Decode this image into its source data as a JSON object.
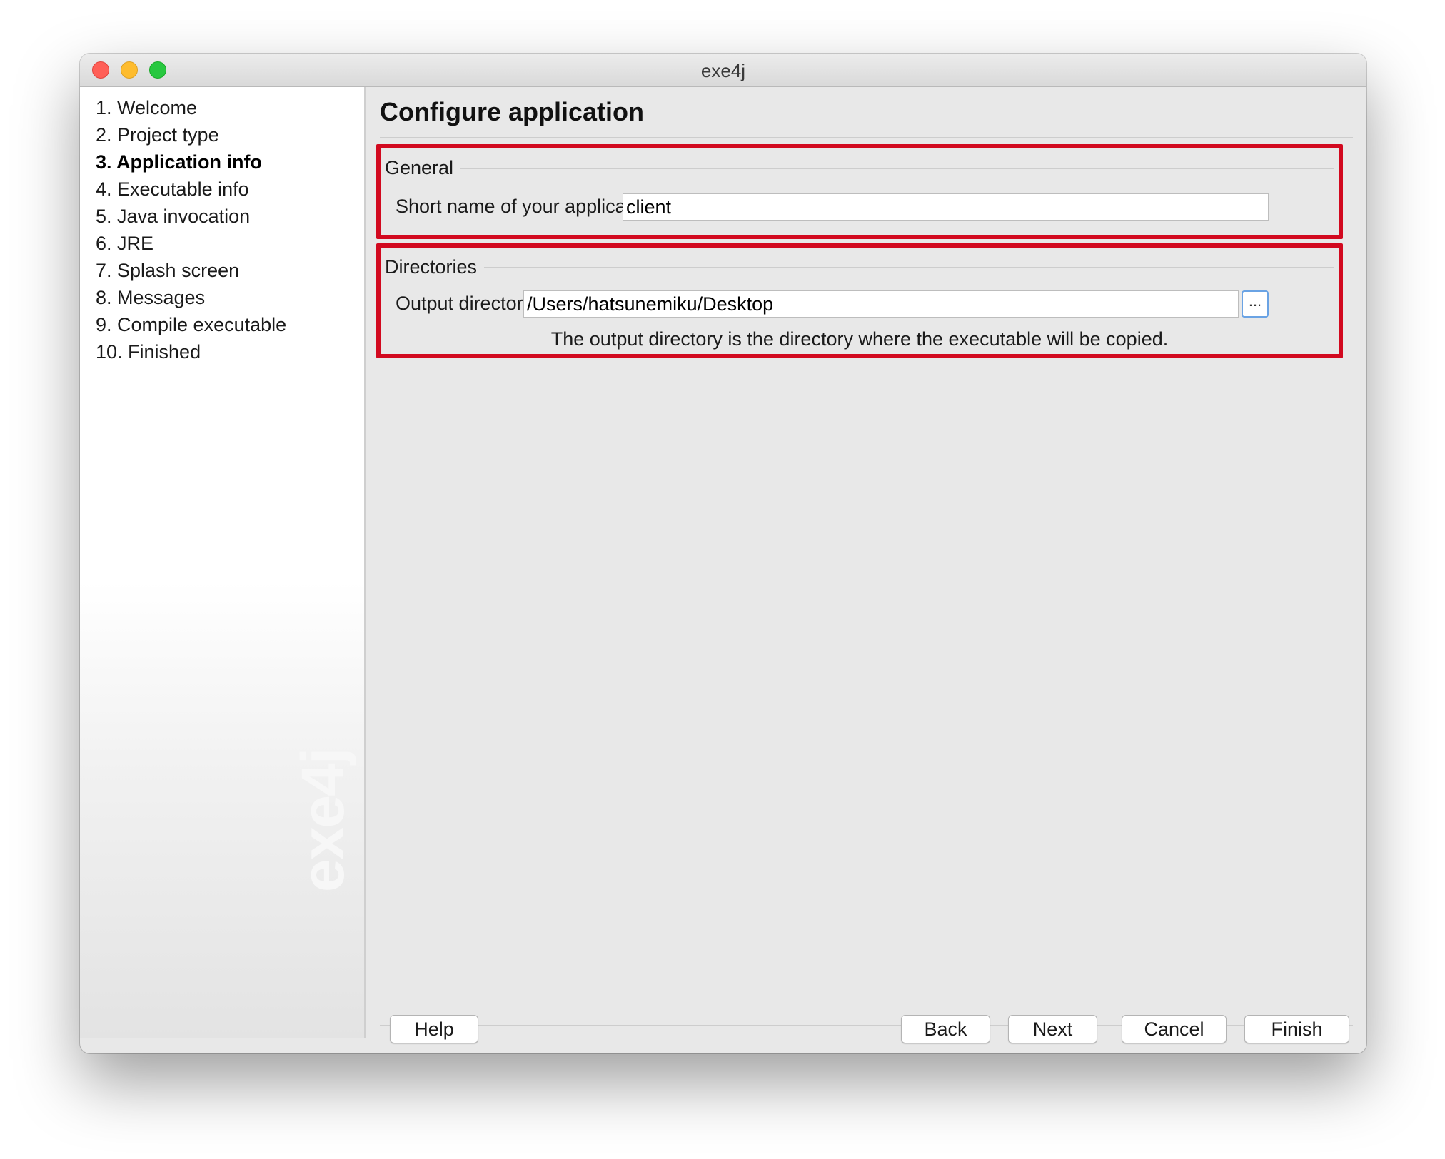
{
  "window": {
    "title": "exe4j"
  },
  "sidebar": {
    "steps": [
      {
        "label": "1. Welcome",
        "active": false
      },
      {
        "label": "2. Project type",
        "active": false
      },
      {
        "label": "3. Application info",
        "active": true
      },
      {
        "label": "4. Executable info",
        "active": false
      },
      {
        "label": "5. Java invocation",
        "active": false
      },
      {
        "label": "6. JRE",
        "active": false
      },
      {
        "label": "7. Splash screen",
        "active": false
      },
      {
        "label": "8. Messages",
        "active": false
      },
      {
        "label": "9. Compile executable",
        "active": false
      },
      {
        "label": "10. Finished",
        "active": false
      }
    ],
    "watermark": "exe4j"
  },
  "main": {
    "title": "Configure application",
    "general": {
      "title": "General",
      "short_name_label": "Short name of your application:",
      "short_name_value": "client"
    },
    "directories": {
      "title": "Directories",
      "output_label": "Output directory:",
      "output_value": "/Users/hatsunemiku/Desktop",
      "browse_label": "...",
      "hint": "The output directory is the directory where the executable will be copied."
    }
  },
  "buttons": {
    "help": "Help",
    "back": "Back",
    "next": "Next",
    "cancel": "Cancel",
    "finish": "Finish"
  },
  "colors": {
    "highlight_box": "#d2091f",
    "window_bg": "#e8e8e8",
    "browse_focus": "#6aa3e4"
  }
}
